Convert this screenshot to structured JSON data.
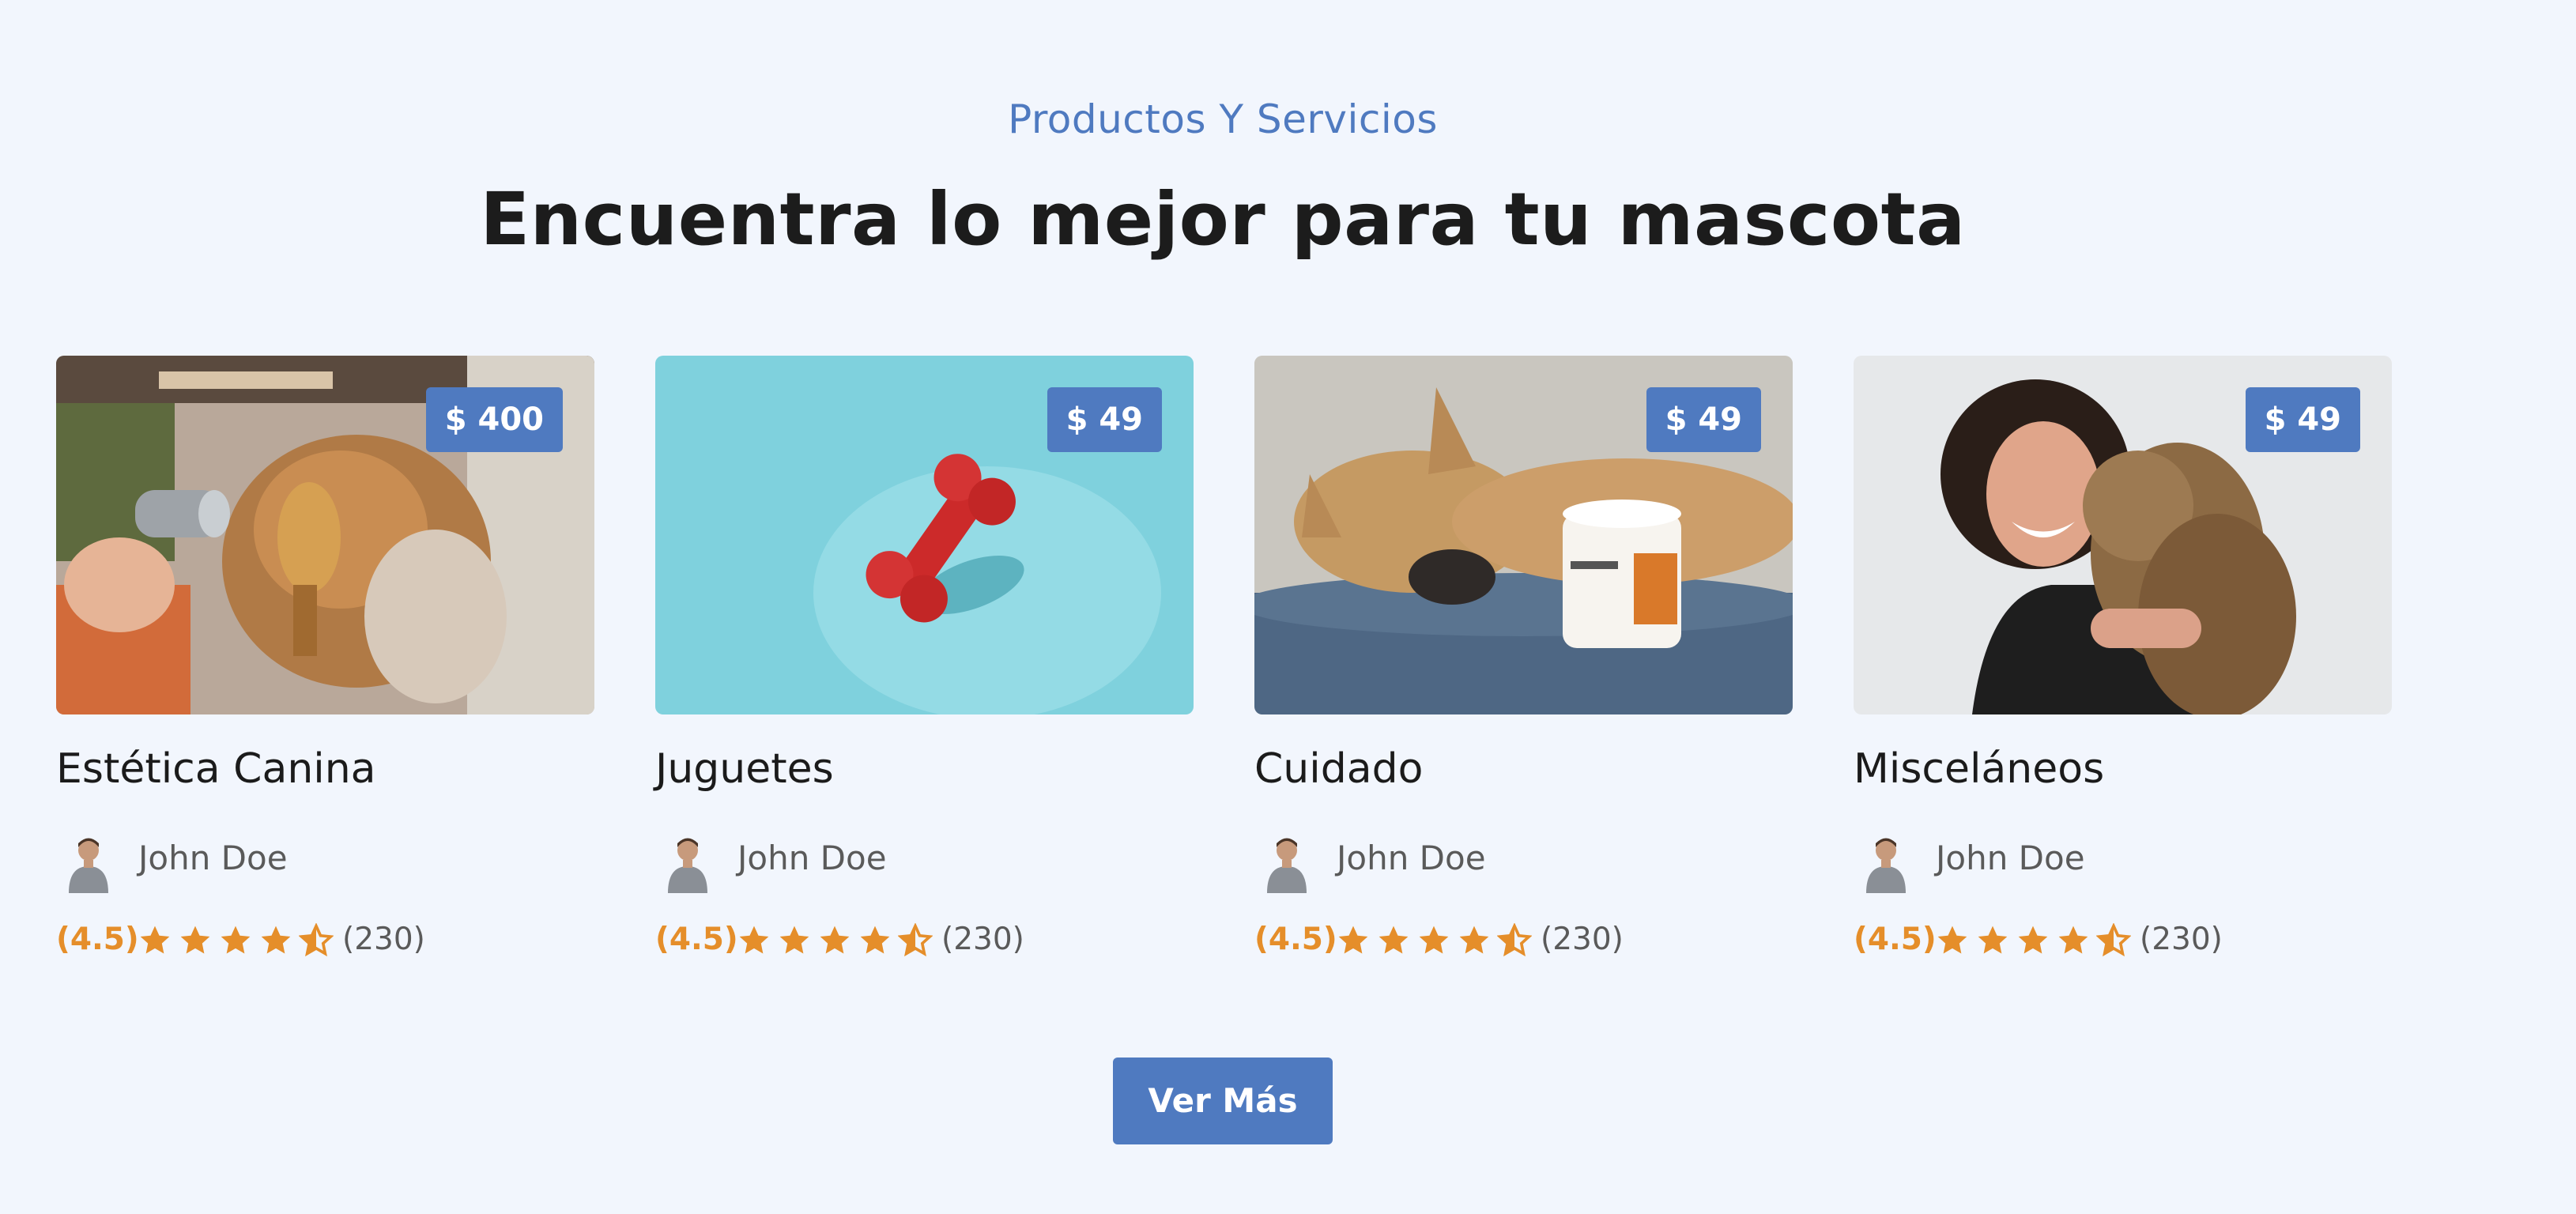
{
  "section": {
    "subtitle": "Productos Y Servicios",
    "title": "Encuentra lo mejor para tu mascota"
  },
  "cards": [
    {
      "title": "Estética Canina",
      "price": "$ 400",
      "image_icon": "grooming-photo",
      "author": "John Doe",
      "rating": "(4.5)",
      "stars": 4.5,
      "reviews": "(230)"
    },
    {
      "title": "Juguetes",
      "price": "$ 49",
      "image_icon": "bone-toy-photo",
      "author": "John Doe",
      "rating": "(4.5)",
      "stars": 4.5,
      "reviews": "(230)"
    },
    {
      "title": "Cuidado",
      "price": "$ 49",
      "image_icon": "dog-with-supplement-photo",
      "author": "John Doe",
      "rating": "(4.5)",
      "stars": 4.5,
      "reviews": "(230)"
    },
    {
      "title": "Misceláneos",
      "price": "$ 49",
      "image_icon": "woman-with-dog-photo",
      "author": "John Doe",
      "rating": "(4.5)",
      "stars": 4.5,
      "reviews": "(230)"
    }
  ],
  "more_button": "Ver Más",
  "colors": {
    "accent": "#4f7ac0",
    "star": "#e58e2a",
    "background": "#f2f6fd"
  }
}
